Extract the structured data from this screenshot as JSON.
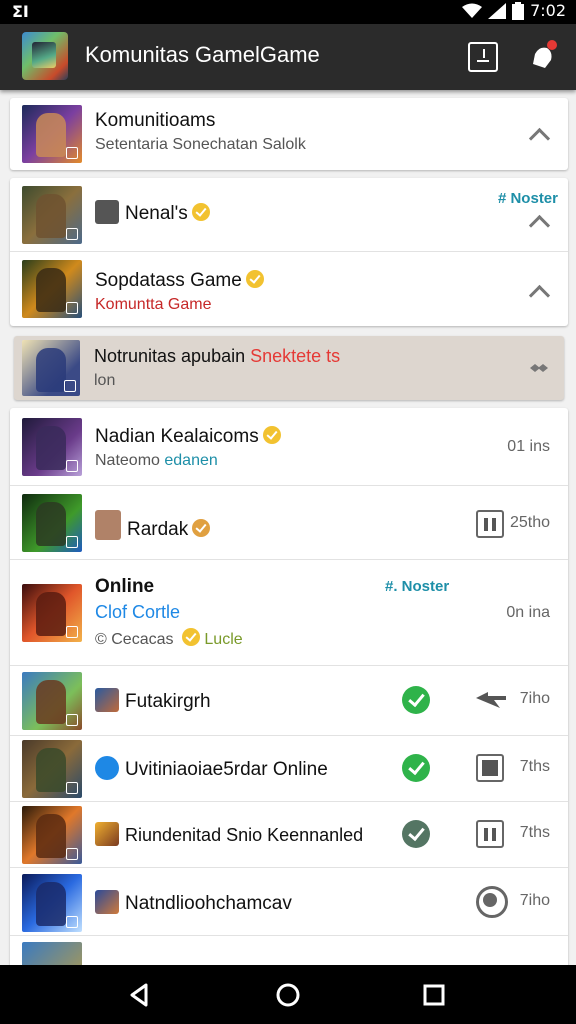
{
  "status_bar": {
    "left_glyph": "ΣΙ",
    "time": "7:02",
    "icons": [
      "wifi-icon",
      "signal-icon",
      "battery-icon"
    ]
  },
  "app_bar": {
    "title": "Komunitas GamelGame",
    "actions": [
      "compose-icon",
      "notification-icon"
    ]
  },
  "pinned": {
    "title": "Komunitioams",
    "subtitle": "Setentaria Sonechatan Salolk"
  },
  "group1": [
    {
      "title": "Nenal's",
      "badge": "# Noster",
      "verified": true
    },
    {
      "title": "Sopdatass Game",
      "subtitle": "Komuntta Game",
      "verified": true
    }
  ],
  "highlight": {
    "title": "Notrunitas apubain",
    "title_red": "Snektete ts",
    "subtitle": "lon"
  },
  "rows": [
    {
      "title": "Nadian Kealaicoms",
      "subtitle": "Nateomo",
      "subtitle_teal": "edanen",
      "time": "01 ins",
      "verified": true
    },
    {
      "title": "Rardak",
      "time": "25tho",
      "verified": true
    },
    {
      "title": "Online",
      "line2": "Clof Cortle",
      "line3": "© Cecacas",
      "line3b": "Lucle",
      "tag": "#. Noster",
      "time": "0n ina"
    },
    {
      "title": "Futakirgrh",
      "time": "7iho"
    },
    {
      "title": "Uvitiniaoiae5rdar Online",
      "time": "7ths"
    },
    {
      "title": "Riundenitad Snio Keennanled",
      "time": "7ths"
    },
    {
      "title": "Natndlioohchamcav",
      "time": "7iho"
    }
  ],
  "colors": {
    "appbar": "#2b2b2b",
    "accent_green": "#2fb34a",
    "accent_teal": "#1e8fa8",
    "accent_red": "#c62828",
    "highlight_bg": "#ddd6cf"
  },
  "nav": [
    "back-icon",
    "home-icon",
    "recents-icon"
  ]
}
